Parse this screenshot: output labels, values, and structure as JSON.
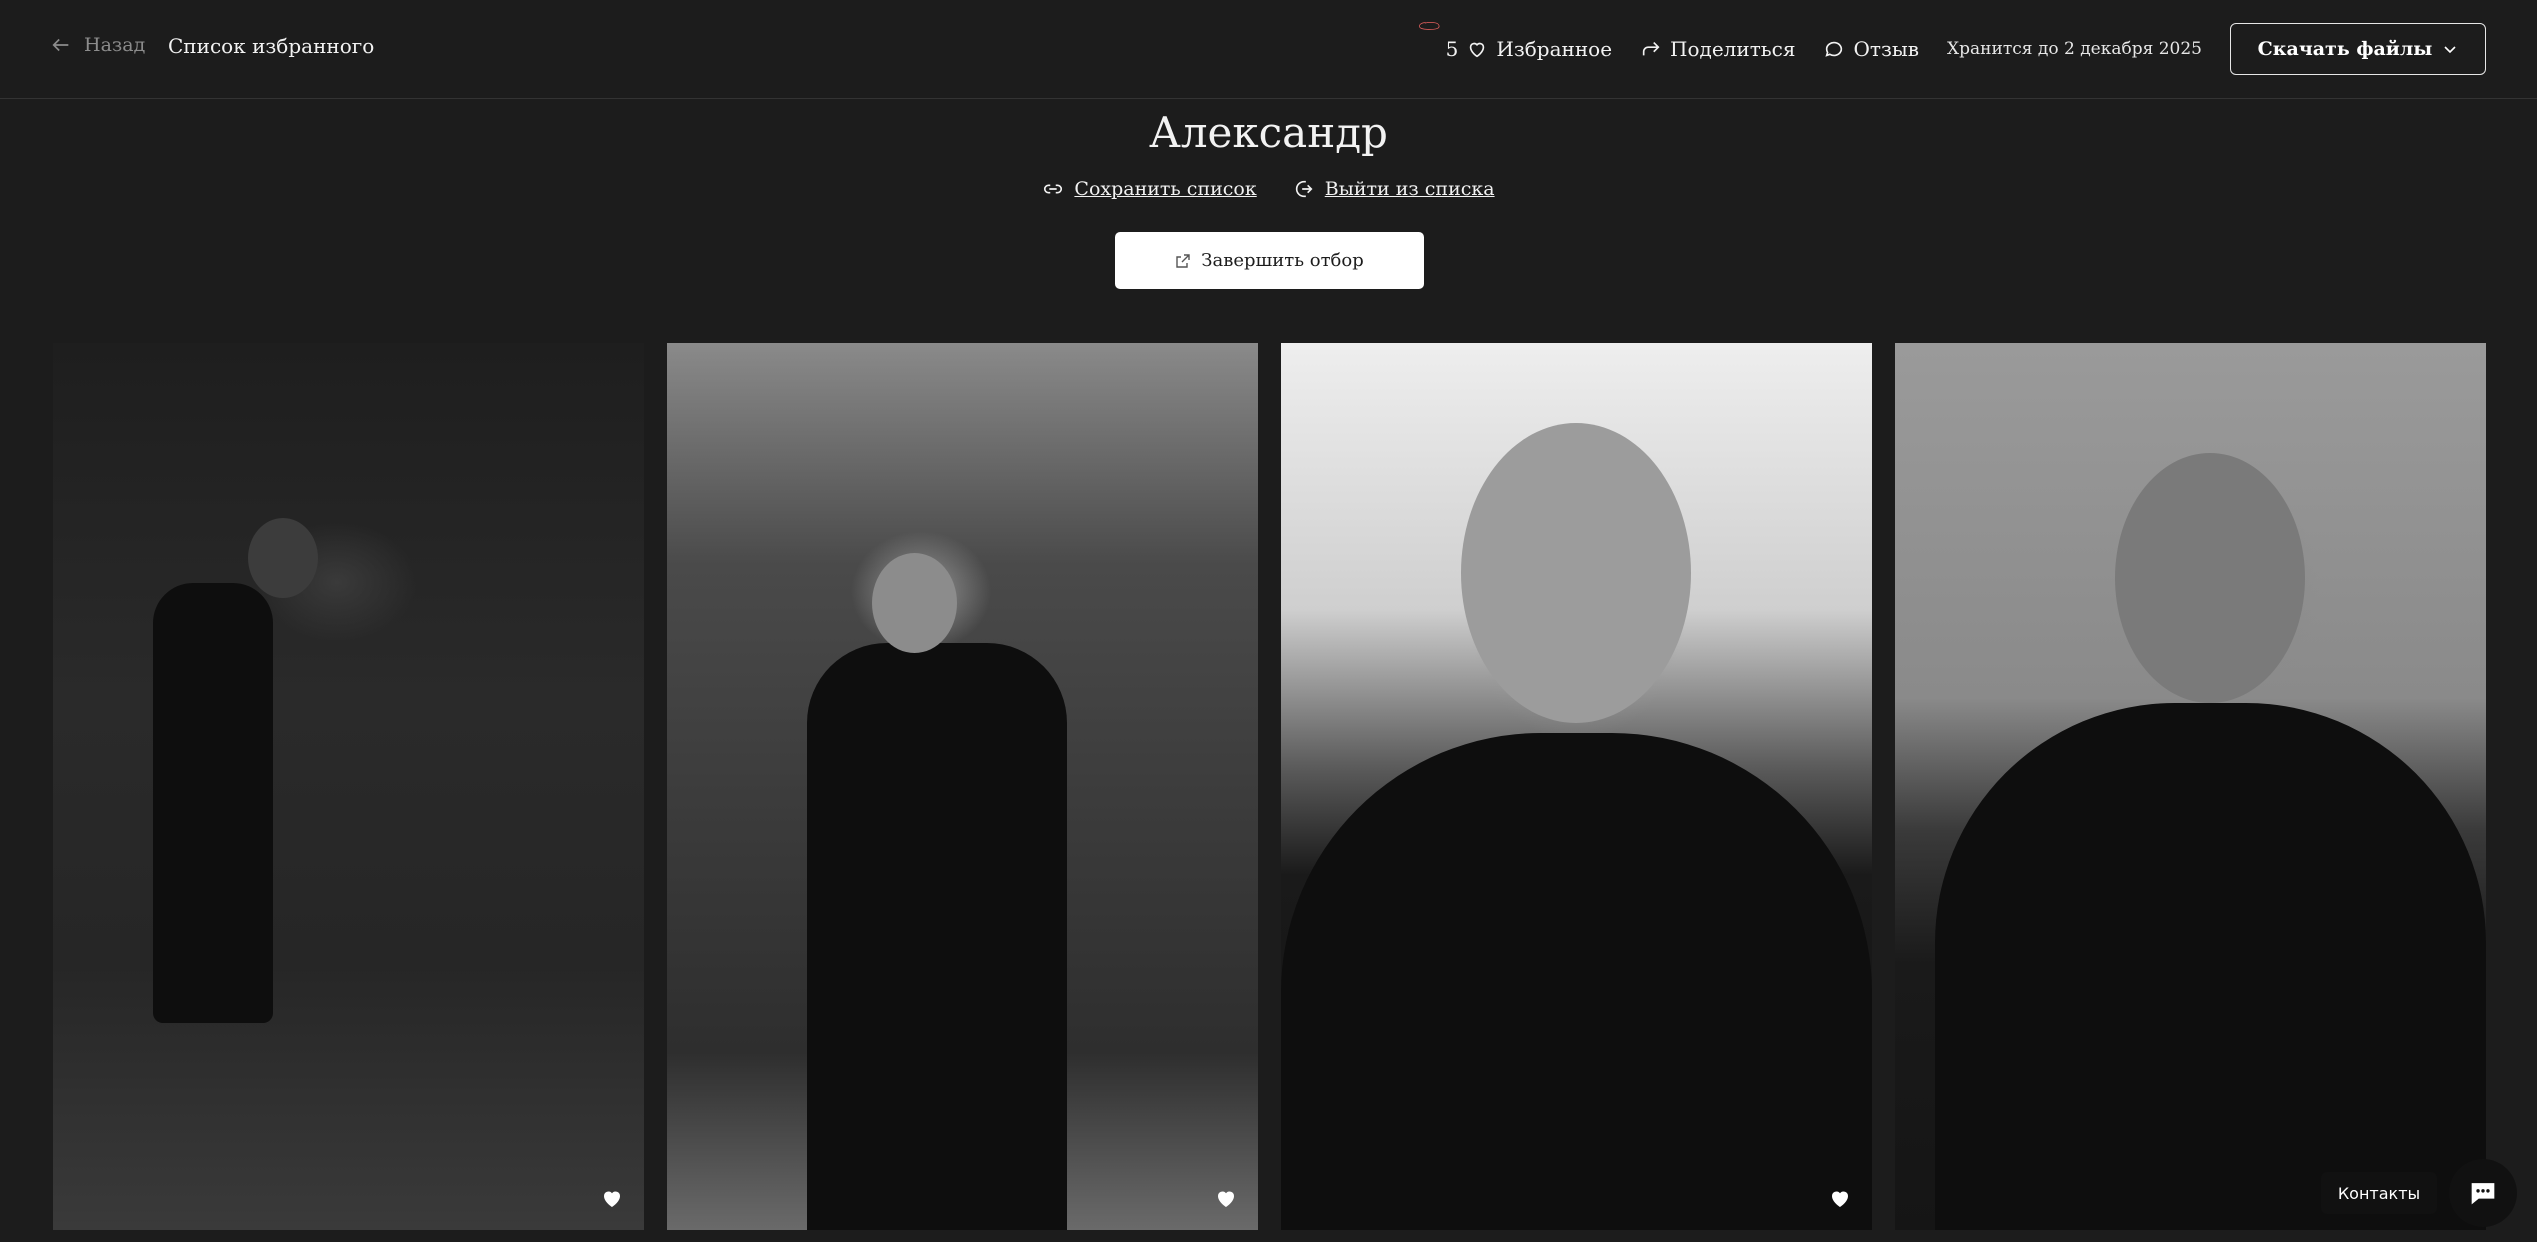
{
  "header": {
    "back_label": "Назад",
    "list_title": "Список избранного",
    "favorites_count": "5",
    "favorites_label": "Избранное",
    "share_label": "Поделиться",
    "review_label": "Отзыв",
    "stored_until": "Хранится до 2 декабря 2025",
    "download_label": "Скачать файлы"
  },
  "page": {
    "title": "Александр",
    "save_list_label": "Сохранить список",
    "leave_list_label": "Выйти из списка",
    "finish_label": "Завершить отбор"
  },
  "photos": [
    {
      "name": "photo-1",
      "favorited": true
    },
    {
      "name": "photo-2",
      "favorited": true
    },
    {
      "name": "photo-3",
      "favorited": true
    },
    {
      "name": "photo-4",
      "favorited": false
    }
  ],
  "widget": {
    "contacts_label": "Контакты"
  },
  "colors": {
    "background": "#1c1c1c",
    "annotation_circle": "#e8625f",
    "button_white": "#ffffff"
  },
  "icons": [
    "arrow-left-icon",
    "heart-outline-icon",
    "share-arrow-icon",
    "chat-bubble-icon",
    "chevron-down-icon",
    "link-icon",
    "exit-icon",
    "external-link-icon",
    "heart-filled-icon",
    "chat-widget-icon"
  ]
}
